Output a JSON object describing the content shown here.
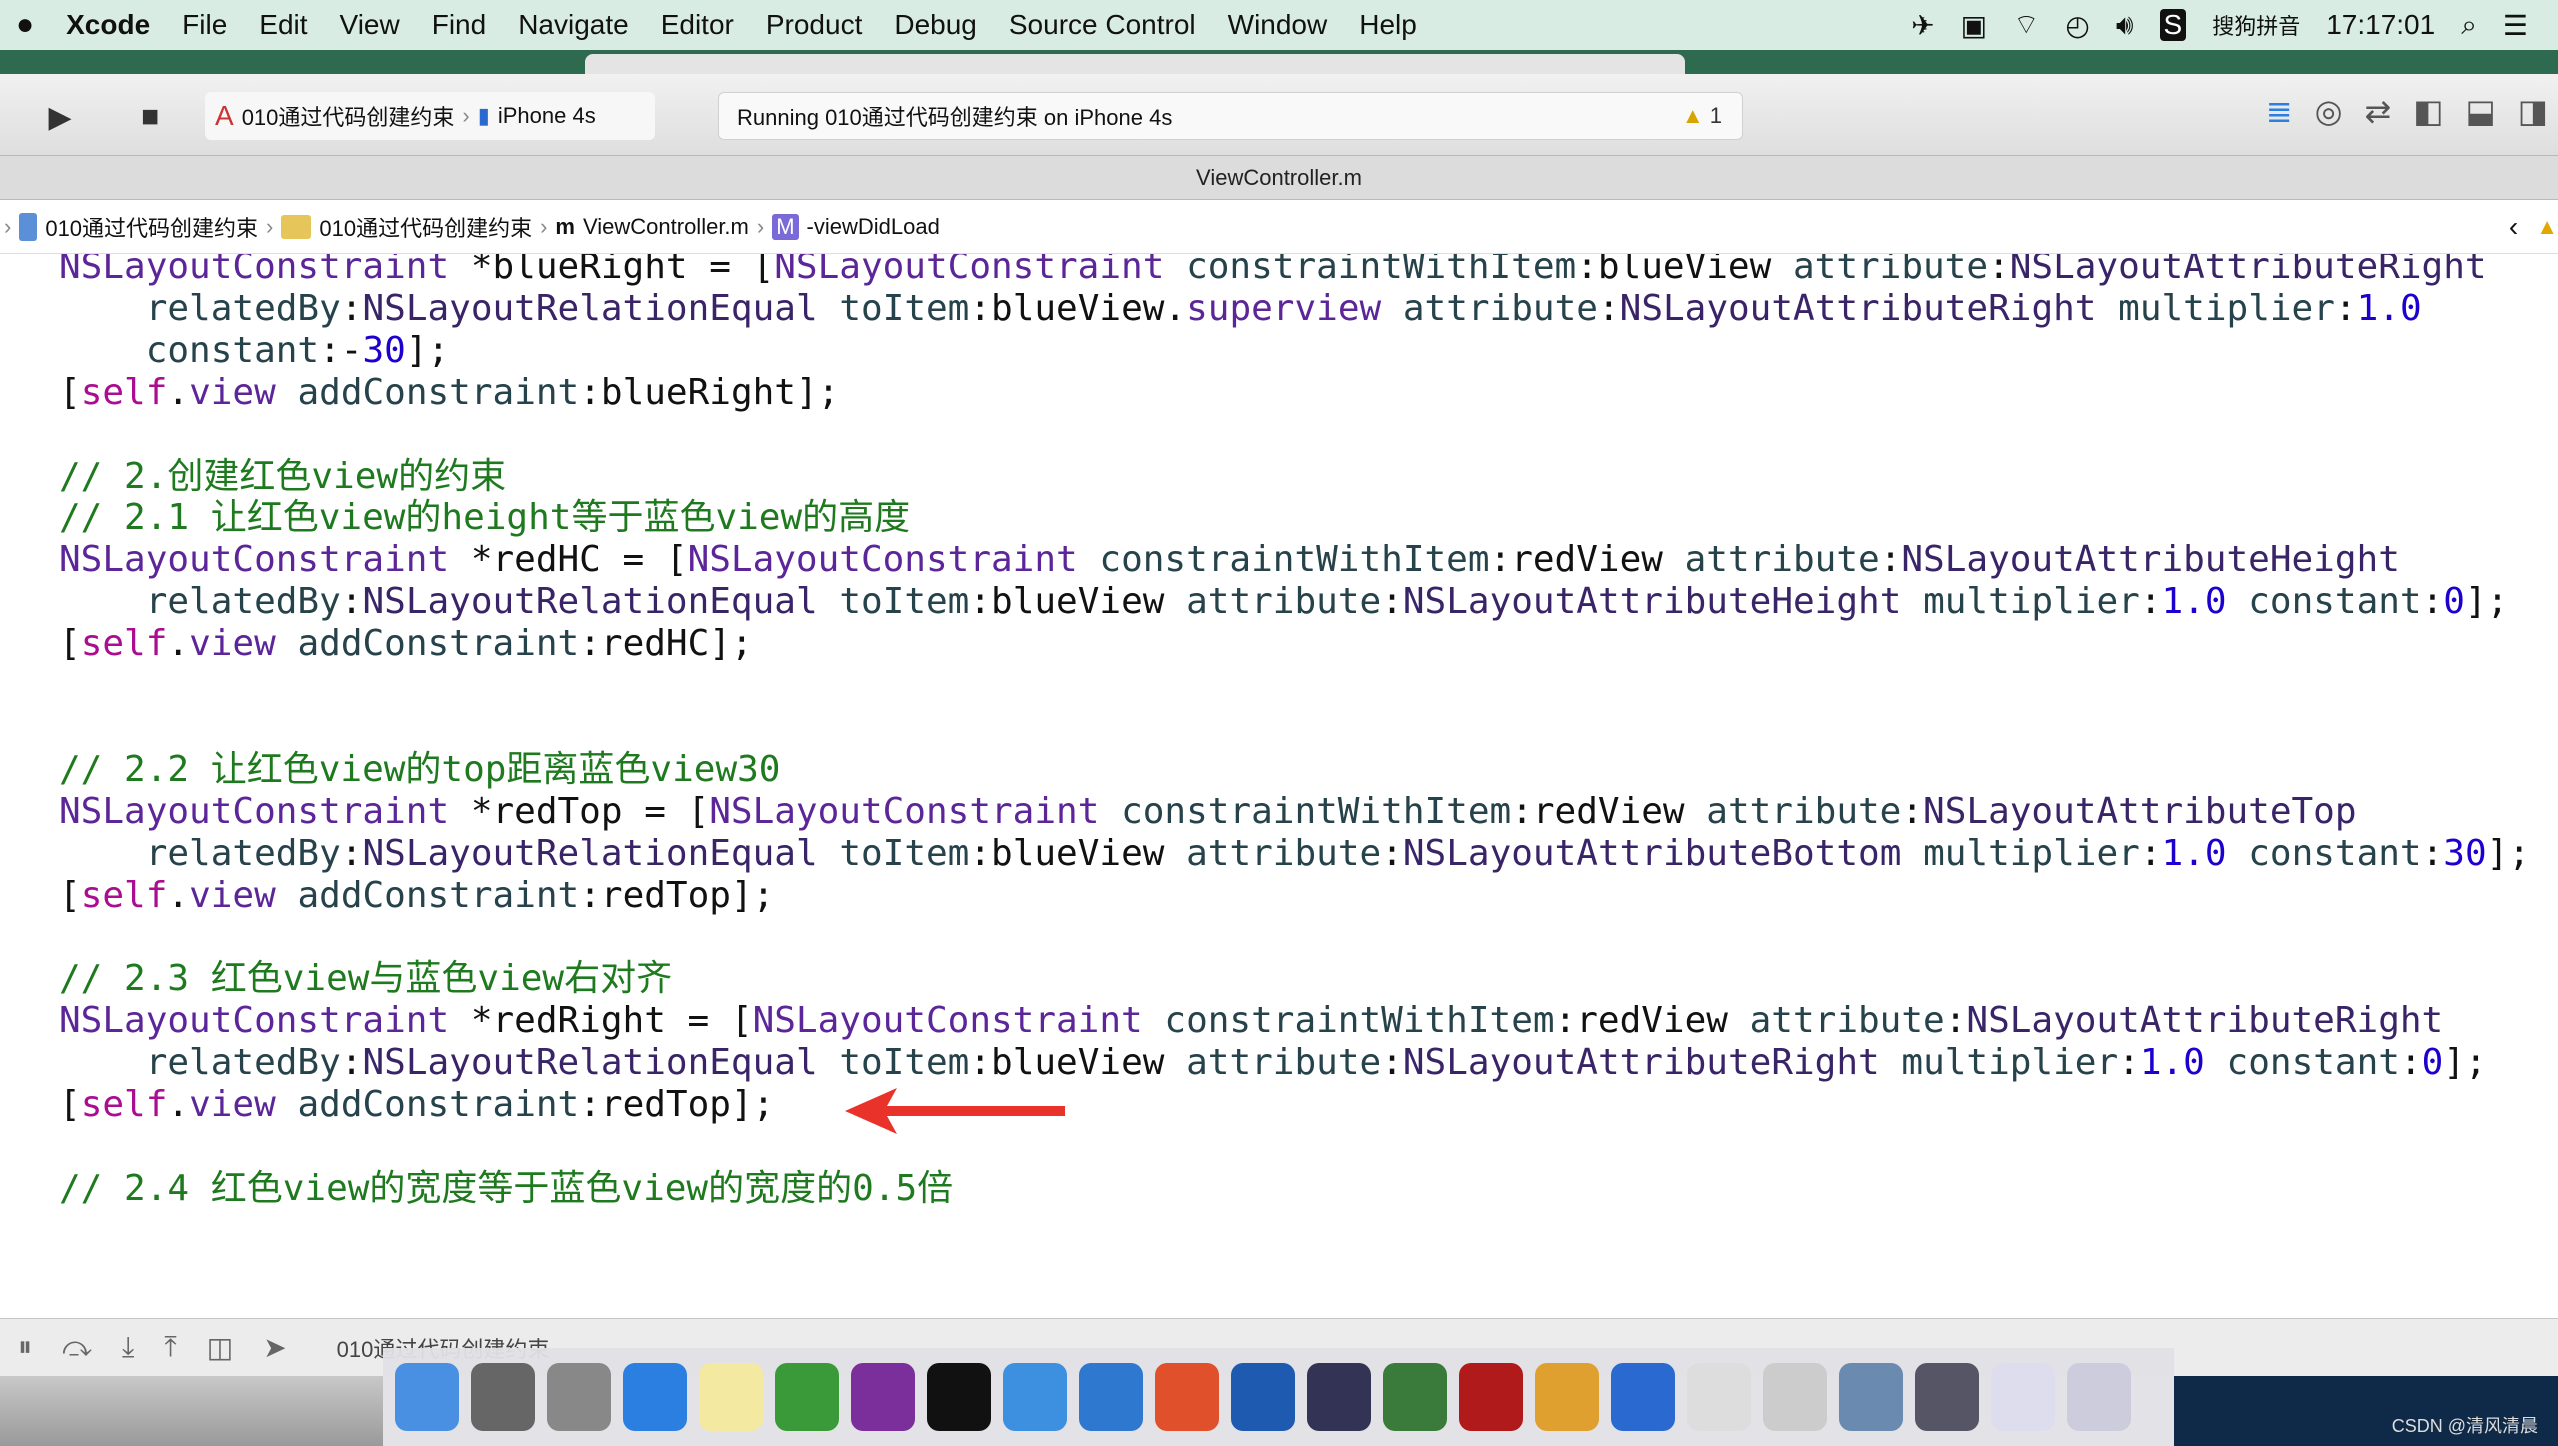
{
  "menubar": {
    "apple": "",
    "app": "Xcode",
    "items": [
      "File",
      "Edit",
      "View",
      "Find",
      "Navigate",
      "Editor",
      "Product",
      "Debug",
      "Source Control",
      "Window",
      "Help"
    ],
    "input_method": "搜狗拼音",
    "clock": "17:17:01"
  },
  "toolbar": {
    "scheme": "010通过代码创建约束",
    "device": "iPhone 4s",
    "status": "Running 010通过代码创建约束 on iPhone 4s",
    "warnings": "1"
  },
  "tab": {
    "title": "ViewController.m"
  },
  "jumpbar": [
    "010通过代码创建约束",
    "010通过代码创建约束",
    "ViewController.m",
    "-viewDidLoad"
  ],
  "code": [
    "NSLayoutConstraint *blueRight = [NSLayoutConstraint constraintWithItem:blueView attribute:NSLayoutAttributeRight",
    "    relatedBy:NSLayoutRelationEqual toItem:blueView.superview attribute:NSLayoutAttributeRight multiplier:1.0",
    "    constant:-30];",
    "[self.view addConstraint:blueRight];",
    "",
    "// 2.创建红色view的约束",
    "// 2.1 让红色view的height等于蓝色view的高度",
    "NSLayoutConstraint *redHC = [NSLayoutConstraint constraintWithItem:redView attribute:NSLayoutAttributeHeight",
    "    relatedBy:NSLayoutRelationEqual toItem:blueView attribute:NSLayoutAttributeHeight multiplier:1.0 constant:0];",
    "[self.view addConstraint:redHC];",
    "",
    "",
    "// 2.2 让红色view的top距离蓝色view30",
    "NSLayoutConstraint *redTop = [NSLayoutConstraint constraintWithItem:redView attribute:NSLayoutAttributeTop",
    "    relatedBy:NSLayoutRelationEqual toItem:blueView attribute:NSLayoutAttributeBottom multiplier:1.0 constant:30];",
    "[self.view addConstraint:redTop];",
    "",
    "// 2.3 红色view与蓝色view右对齐",
    "NSLayoutConstraint *redRight = [NSLayoutConstraint constraintWithItem:redView attribute:NSLayoutAttributeRight",
    "    relatedBy:NSLayoutRelationEqual toItem:blueView attribute:NSLayoutAttributeRight multiplier:1.0 constant:0];",
    "[self.view addConstraint:redTop];",
    "",
    "// 2.4 红色view的宽度等于蓝色view的宽度的0.5倍"
  ],
  "annotation": {
    "arrow_color": "#e8322a"
  },
  "debugbar": {
    "title": "010通过代码创建约束"
  },
  "dock": [
    {
      "name": "finder",
      "color": "#4a90e2"
    },
    {
      "name": "system-preferences",
      "color": "#666"
    },
    {
      "name": "launchpad",
      "color": "#888"
    },
    {
      "name": "safari",
      "color": "#2a7fe0"
    },
    {
      "name": "notes",
      "color": "#f4e9a0"
    },
    {
      "name": "excel",
      "color": "#3a9a3a"
    },
    {
      "name": "onenote",
      "color": "#7a2f9a"
    },
    {
      "name": "terminal",
      "color": "#111"
    },
    {
      "name": "xcode",
      "color": "#3d8fe0"
    },
    {
      "name": "preview",
      "color": "#2f78d0"
    },
    {
      "name": "powerpoint",
      "color": "#e0502a"
    },
    {
      "name": "scissors-tool",
      "color": "#1d5ab0"
    },
    {
      "name": "photo-slideshow",
      "color": "#335"
    },
    {
      "name": "network-tool",
      "color": "#3a7a3a"
    },
    {
      "name": "filezilla",
      "color": "#b01a1a"
    },
    {
      "name": "sketch-tool",
      "color": "#e0a030"
    },
    {
      "name": "word",
      "color": "#2a6ad0"
    },
    {
      "name": "textedit",
      "color": "#ddd"
    },
    {
      "name": "font-book",
      "color": "#ccc"
    },
    {
      "name": "image-capture",
      "color": "#6a8ab0"
    },
    {
      "name": "remote-desktop",
      "color": "#556"
    },
    {
      "name": "downloads",
      "color": "#dde"
    },
    {
      "name": "trash",
      "color": "#ccd"
    }
  ],
  "watermark": "CSDN @清风清晨"
}
